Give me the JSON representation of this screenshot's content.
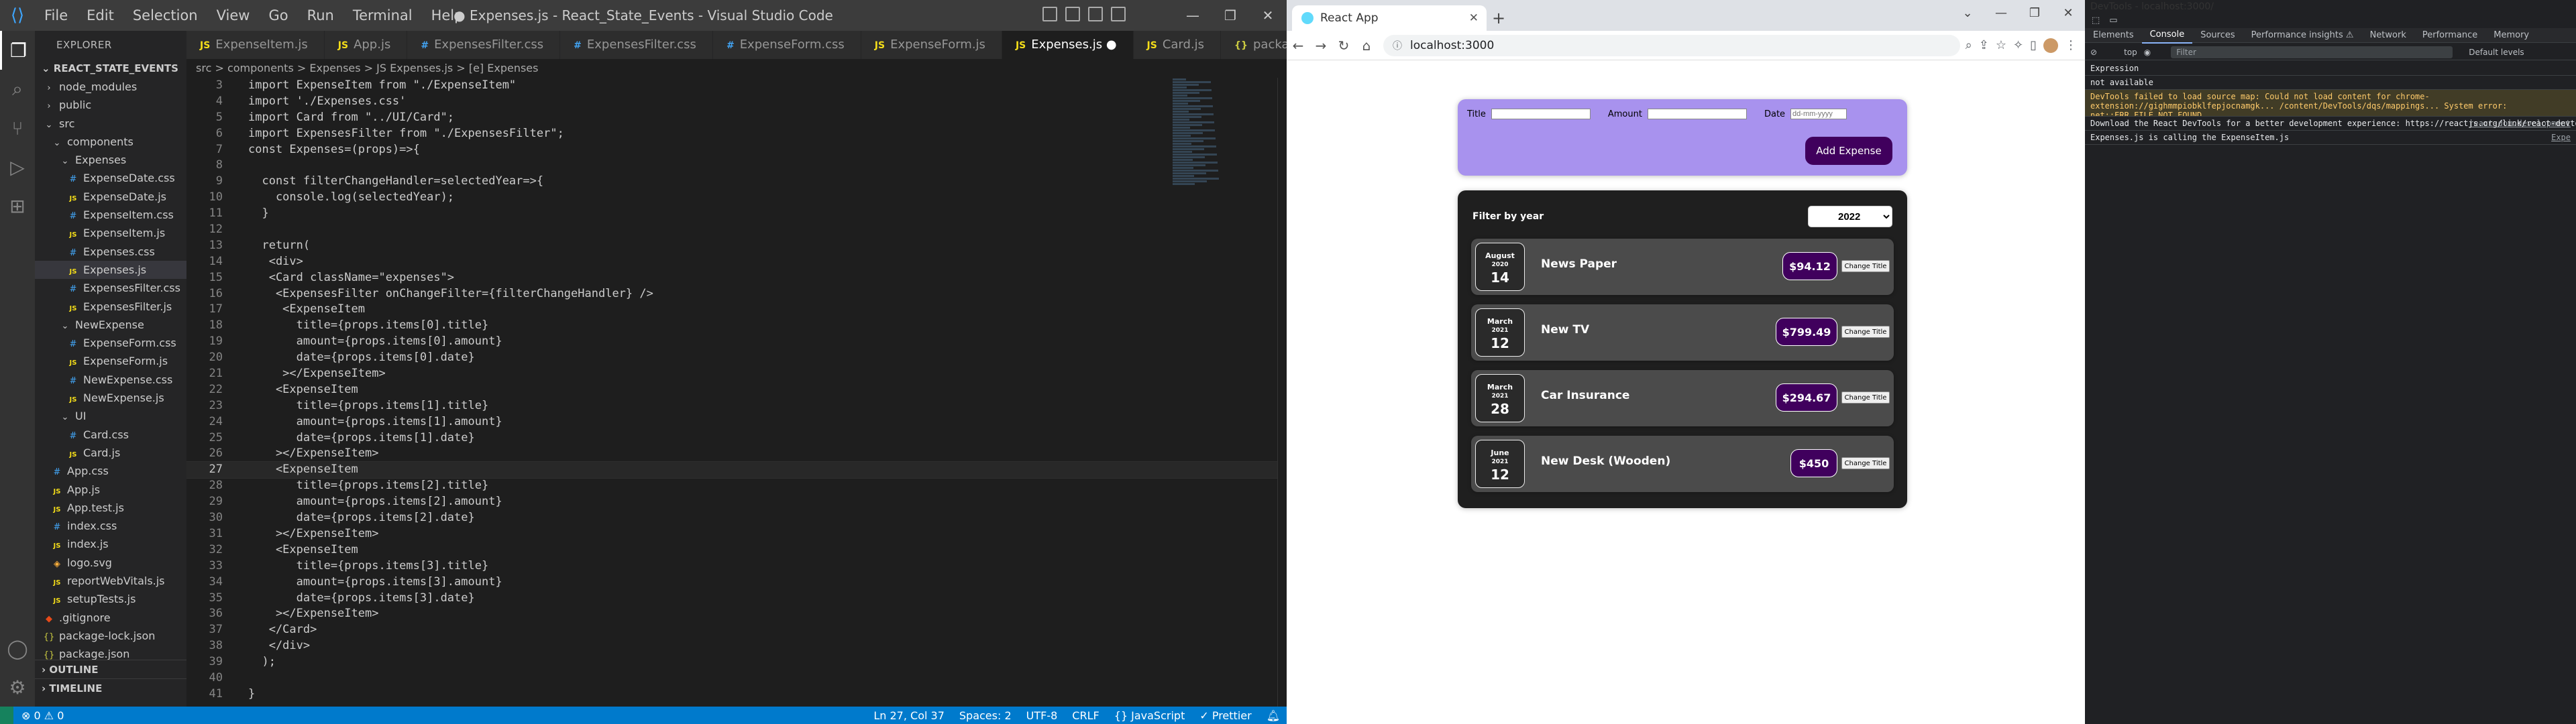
{
  "vscode": {
    "window_title": "● Expenses.js - React_State_Events - Visual Studio Code",
    "menu": [
      "File",
      "Edit",
      "Selection",
      "View",
      "Go",
      "Run",
      "Terminal",
      "Help"
    ],
    "explorer_label": "EXPLORER",
    "project": "REACT_STATE_EVENTS",
    "tree": [
      {
        "name": "node_modules",
        "type": "folder",
        "indent": 1
      },
      {
        "name": "public",
        "type": "folder",
        "indent": 1
      },
      {
        "name": "src",
        "type": "folder-open",
        "indent": 1
      },
      {
        "name": "components",
        "type": "folder-open",
        "indent": 2
      },
      {
        "name": "Expenses",
        "type": "folder-open",
        "indent": 3
      },
      {
        "name": "ExpenseDate.css",
        "type": "css",
        "indent": 4
      },
      {
        "name": "ExpenseDate.js",
        "type": "js",
        "indent": 4
      },
      {
        "name": "ExpenseItem.css",
        "type": "css",
        "indent": 4
      },
      {
        "name": "ExpenseItem.js",
        "type": "js",
        "indent": 4
      },
      {
        "name": "Expenses.css",
        "type": "css",
        "indent": 4
      },
      {
        "name": "Expenses.js",
        "type": "js",
        "indent": 4,
        "selected": true
      },
      {
        "name": "ExpensesFilter.css",
        "type": "css",
        "indent": 4
      },
      {
        "name": "ExpensesFilter.js",
        "type": "js",
        "indent": 4
      },
      {
        "name": "NewExpense",
        "type": "folder-open",
        "indent": 3
      },
      {
        "name": "ExpenseForm.css",
        "type": "css",
        "indent": 4
      },
      {
        "name": "ExpenseForm.js",
        "type": "js",
        "indent": 4
      },
      {
        "name": "NewExpense.css",
        "type": "css",
        "indent": 4
      },
      {
        "name": "NewExpense.js",
        "type": "js",
        "indent": 4
      },
      {
        "name": "UI",
        "type": "folder-open",
        "indent": 3
      },
      {
        "name": "Card.css",
        "type": "css",
        "indent": 4
      },
      {
        "name": "Card.js",
        "type": "js",
        "indent": 4
      },
      {
        "name": "App.css",
        "type": "css",
        "indent": 2
      },
      {
        "name": "App.js",
        "type": "js",
        "indent": 2
      },
      {
        "name": "App.test.js",
        "type": "js",
        "indent": 2
      },
      {
        "name": "index.css",
        "type": "css",
        "indent": 2
      },
      {
        "name": "index.js",
        "type": "js",
        "indent": 2
      },
      {
        "name": "logo.svg",
        "type": "svg",
        "indent": 2
      },
      {
        "name": "reportWebVitals.js",
        "type": "js",
        "indent": 2
      },
      {
        "name": "setupTests.js",
        "type": "js",
        "indent": 2
      },
      {
        "name": ".gitignore",
        "type": "git",
        "indent": 1
      },
      {
        "name": "package-lock.json",
        "type": "json",
        "indent": 1
      },
      {
        "name": "package.json",
        "type": "json",
        "indent": 1
      }
    ],
    "outline_label": "OUTLINE",
    "timeline_label": "TIMELINE",
    "tabs": [
      {
        "icon": "JS",
        "label": "ExpenseItem.js"
      },
      {
        "icon": "JS",
        "label": "App.js"
      },
      {
        "icon": "#",
        "label": "ExpensesFilter.css"
      },
      {
        "icon": "#",
        "label": "ExpensesFilter.css"
      },
      {
        "icon": "#",
        "label": "ExpenseForm.css"
      },
      {
        "icon": "JS",
        "label": "ExpenseForm.js"
      },
      {
        "icon": "JS",
        "label": "Expenses.js ●",
        "active": true
      },
      {
        "icon": "JS",
        "label": "Card.js"
      },
      {
        "icon": "{}",
        "label": "package.json"
      }
    ],
    "breadcrumb": "src > components > Expenses > JS Expenses.js > [e] Expenses",
    "code_lines": [
      {
        "n": "3",
        "t": "import ExpenseItem from \"./ExpenseItem\""
      },
      {
        "n": "4",
        "t": "import './Expenses.css'"
      },
      {
        "n": "5",
        "t": "import Card from \"../UI/Card\";"
      },
      {
        "n": "6",
        "t": "import ExpensesFilter from \"./ExpensesFilter\";"
      },
      {
        "n": "7",
        "t": "const Expenses=(props)=>{"
      },
      {
        "n": "8",
        "t": ""
      },
      {
        "n": "9",
        "t": "  const filterChangeHandler=selectedYear=>{"
      },
      {
        "n": "10",
        "t": "    console.log(selectedYear);"
      },
      {
        "n": "11",
        "t": "  }"
      },
      {
        "n": "12",
        "t": ""
      },
      {
        "n": "13",
        "t": "  return("
      },
      {
        "n": "14",
        "t": "   <div>"
      },
      {
        "n": "15",
        "t": "   <Card className=\"expenses\">"
      },
      {
        "n": "16",
        "t": "    <ExpensesFilter onChangeFilter={filterChangeHandler} />"
      },
      {
        "n": "17",
        "t": "     <ExpenseItem"
      },
      {
        "n": "18",
        "t": "       title={props.items[0].title}"
      },
      {
        "n": "19",
        "t": "       amount={props.items[0].amount}"
      },
      {
        "n": "20",
        "t": "       date={props.items[0].date}"
      },
      {
        "n": "21",
        "t": "     ></ExpenseItem>"
      },
      {
        "n": "22",
        "t": "    <ExpenseItem"
      },
      {
        "n": "23",
        "t": "       title={props.items[1].title}"
      },
      {
        "n": "24",
        "t": "       amount={props.items[1].amount}"
      },
      {
        "n": "25",
        "t": "       date={props.items[1].date}"
      },
      {
        "n": "26",
        "t": "    ></ExpenseItem>"
      },
      {
        "n": "27",
        "t": "    <ExpenseItem",
        "cur": true
      },
      {
        "n": "28",
        "t": "       title={props.items[2].title}"
      },
      {
        "n": "29",
        "t": "       amount={props.items[2].amount}"
      },
      {
        "n": "30",
        "t": "       date={props.items[2].date}"
      },
      {
        "n": "31",
        "t": "    ></ExpenseItem>"
      },
      {
        "n": "32",
        "t": "    <ExpenseItem"
      },
      {
        "n": "33",
        "t": "       title={props.items[3].title}"
      },
      {
        "n": "34",
        "t": "       amount={props.items[3].amount}"
      },
      {
        "n": "35",
        "t": "       date={props.items[3].date}"
      },
      {
        "n": "36",
        "t": "    ></ExpenseItem>"
      },
      {
        "n": "37",
        "t": "   </Card>"
      },
      {
        "n": "38",
        "t": "   </div>"
      },
      {
        "n": "39",
        "t": "  );"
      },
      {
        "n": "40",
        "t": ""
      },
      {
        "n": "41",
        "t": "}"
      }
    ],
    "status_left": "⊗ 0 ⚠ 0",
    "status_right": [
      "Ln 27, Col 37",
      "Spaces: 2",
      "UTF-8",
      "CRLF",
      "{} JavaScript",
      "✓ Prettier"
    ]
  },
  "chrome": {
    "tab_title": "React App",
    "url": "localhost:3000",
    "form": {
      "title_label": "Title",
      "amount_label": "Amount",
      "date_label": "Date",
      "date_placeholder": "dd-mm-yyyy",
      "add_button": "Add Expense"
    },
    "filter_label": "Filter by year",
    "filter_value": "2022",
    "change_title_label": "Change Title",
    "items": [
      {
        "month": "August",
        "year": "2020",
        "day": "14",
        "title": "News Paper",
        "price": "$94.12"
      },
      {
        "month": "March",
        "year": "2021",
        "day": "12",
        "title": "New TV",
        "price": "$799.49"
      },
      {
        "month": "March",
        "year": "2021",
        "day": "28",
        "title": "Car Insurance",
        "price": "$294.67"
      },
      {
        "month": "June",
        "year": "2021",
        "day": "12",
        "title": "New Desk (Wooden)",
        "price": "$450"
      }
    ]
  },
  "devtools": {
    "title": "DevTools - localhost:3000/",
    "tabs": [
      "Elements",
      "Console",
      "Sources",
      "Performance insights ⚠",
      "Network",
      "Performance",
      "Memory"
    ],
    "active_tab": "Console",
    "context": "top",
    "filter_placeholder": "Filter",
    "levels": "Default levels",
    "lines": [
      {
        "type": "info",
        "text": "Expression"
      },
      {
        "type": "info",
        "text": "not available"
      },
      {
        "type": "warn",
        "text": "DevTools failed to load source map: Could not load content for chrome-extension://gighmmpiobklfepjocnamgk... /content/DevTools/dqs/mappings... System error: net::ERR_FILE_NOT_FOUND"
      },
      {
        "type": "info",
        "text": "Download the React DevTools for a better development experience: https://reactjs.org/link/react-devtools",
        "src": "react-dom.development"
      },
      {
        "type": "info",
        "text": "Expenses.js is calling the ExpenseItem.js",
        "src": "Expe"
      }
    ]
  }
}
